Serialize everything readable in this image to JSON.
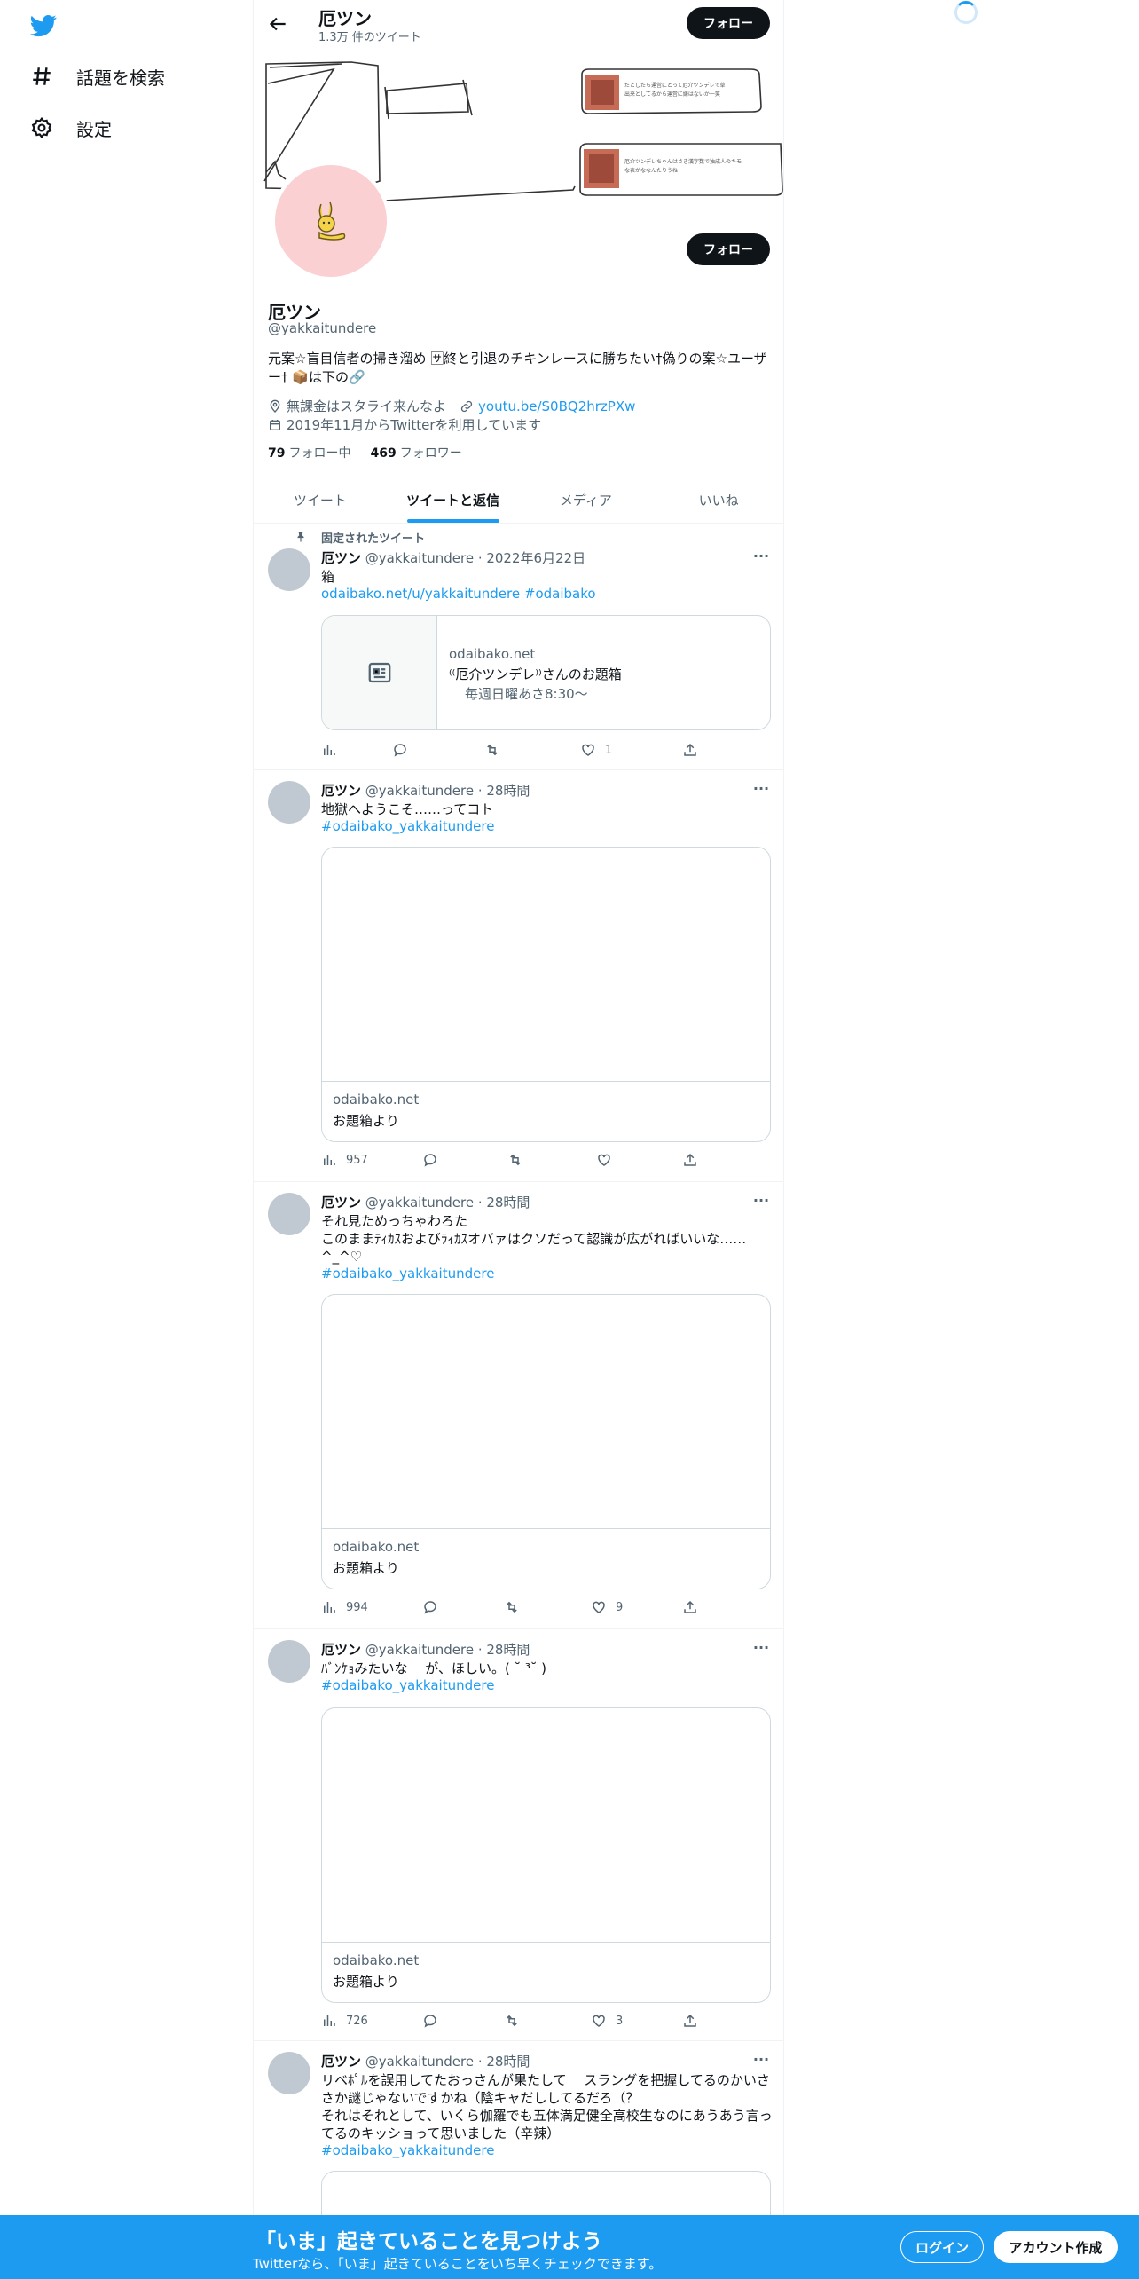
{
  "nav": {
    "explore_label": "話題を検索",
    "settings_label": "設定"
  },
  "topbar": {
    "name": "厄ツン",
    "tweet_count": "1.3万 件のツイート",
    "follow_label": "フォロー"
  },
  "banner": {
    "note1": "だとしたら運営にとって厄介ツンデレで草\n出来としてるから運営に嫌はないか一笑",
    "note2": "厄介ツンデレちゃんはさき漢字数で独成人のキモさんみたいな表がななんたりうね"
  },
  "profile": {
    "name": "厄ツン",
    "handle": "@yakkaitundere",
    "follow_label": "フォロー",
    "bio": "元案☆盲目信者の掃き溜め 🈂終と引退のチキンレースに勝ちたい†偽りの案☆ユーザー† 📦は下の🔗",
    "location": "無課金はスタライ来んなよ",
    "link": "youtu.be/S0BQ2hrzPXw",
    "joined": "2019年11月からTwitterを利用しています",
    "following_count": "79",
    "following_label": "フォロー中",
    "followers_count": "469",
    "followers_label": "フォロワー"
  },
  "tabs": [
    "ツイート",
    "ツイートと返信",
    "メディア",
    "いいね"
  ],
  "tweets": [
    {
      "pinned_label": "固定されたツイート",
      "name": "厄ツン",
      "meta": "@yakkaitundere · 2022年6月22日",
      "text": "箱",
      "link": "odaibako.net/u/yakkaitundere",
      "tag": "#odaibako",
      "card_domain": "odaibako.net",
      "card_title": "⁽⁽厄介ツンデレ⁾⁾さんのお題箱",
      "card_desc": "毎週日曜あさ8:30〜",
      "views": "",
      "likes": "1"
    },
    {
      "name": "厄ツン",
      "meta": "@yakkaitundere · 28時間",
      "text": "地獄へようこそ……ってコト",
      "tag": "#odaibako_yakkaitundere",
      "card_domain": "odaibako.net",
      "card_title": "お題箱より",
      "views": "957",
      "likes": ""
    },
    {
      "name": "厄ツン",
      "meta": "@yakkaitundere · 28時間",
      "text": "それ見ためっちゃわろた\nこのままﾃｨｶｽおよびﾗｨｶｽオバァはクソだって認識が広がればいいな……\n^_^♡",
      "tag": "#odaibako_yakkaitundere",
      "card_domain": "odaibako.net",
      "card_title": "お題箱より",
      "views": "994",
      "likes": "9"
    },
    {
      "name": "厄ツン",
      "meta": "@yakkaitundere · 28時間",
      "text": "ﾊﾞﾝｹｮみたいな　 が、ほしい。( ˘ ³˘ )",
      "tag": "#odaibako_yakkaitundere",
      "card_domain": "odaibako.net",
      "card_title": "お題箱より",
      "views": "726",
      "likes": "3"
    },
    {
      "name": "厄ツン",
      "meta": "@yakkaitundere · 28時間",
      "text": "リベﾎﾟﾙを誤用してたおっさんが果たして　 スラングを把握してるのかいささか謎じゃないですかね（陰キャだししてるだろ（？\nそれはそれとして、いくら伽羅でも五体満足健全高校生なのにあうあう言ってるのキッショって思いました（辛辣）",
      "tag": "#odaibako_yakkaitundere"
    }
  ],
  "bottom_bar": {
    "title": "「いま」起きていることを見つけよう",
    "subtitle": "Twitterなら、「いま」起きていることをいち早くチェックできます。",
    "login_label": "ログイン",
    "signup_label": "アカウント作成"
  }
}
